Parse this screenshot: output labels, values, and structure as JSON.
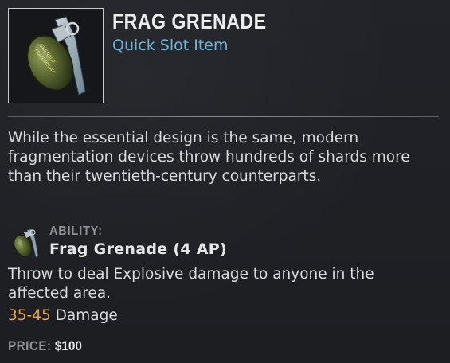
{
  "item": {
    "name": "FRAG GRENADE",
    "type": "Quick Slot Item",
    "icon": "frag-grenade-icon",
    "description": "While the essential design is the same, modern fragmentation devices throw hundreds of shards more than their twentieth-century counterparts."
  },
  "ability": {
    "label": "ABILITY:",
    "name": "Frag Grenade (4 AP)",
    "icon": "frag-grenade-ability-icon",
    "description": "Throw to deal Explosive damage to anyone in the affected area.",
    "damage_range": "35-45",
    "damage_label": "Damage"
  },
  "price": {
    "label": "PRICE:",
    "value": "$100"
  },
  "colors": {
    "title": "#ececec",
    "subtitle": "#6fb3d8",
    "damage_range": "#e9a24a",
    "muted_label": "#8f9296",
    "background": "#1d1f23"
  }
}
